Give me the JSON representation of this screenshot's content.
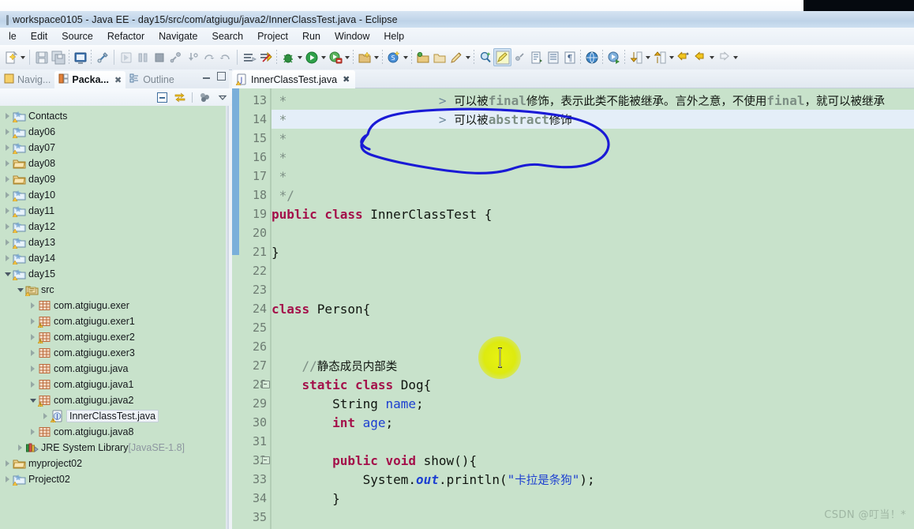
{
  "window": {
    "title": "workspace0105 - Java EE - day15/src/com/atgiugu/java2/InnerClassTest.java - Eclipse"
  },
  "menubar": {
    "items": [
      "le",
      "Edit",
      "Source",
      "Refactor",
      "Navigate",
      "Search",
      "Project",
      "Run",
      "Window",
      "Help"
    ]
  },
  "toolbar": {
    "icons": [
      "new-wizard-icon",
      "new-wizard-dropdown",
      "save-icon",
      "save-all-icon",
      "console-icon",
      "link-icon",
      "resume-icon",
      "suspend-icon",
      "terminate-icon",
      "disconnect-icon",
      "step-into-icon",
      "step-over-icon",
      "step-return-icon",
      "build-all-icon",
      "skip-breakpoints-icon",
      "debug-icon",
      "debug-dropdown",
      "run-icon",
      "run-dropdown",
      "run-last-tool-icon",
      "run-last-tool-dropdown",
      "new-java-project-icon",
      "new-java-project-dropdown",
      "new-class-icon",
      "new-class-dropdown",
      "open-type-icon",
      "open-task-icon",
      "pencil-icon",
      "pencil-dropdown",
      "search-icon",
      "yellow-highlight-icon",
      "toggle-mark-icon",
      "next-annotation-icon",
      "previous-annotation-icon",
      "last-edit-icon",
      "open-browser-icon",
      "external-tools-icon",
      "down-arrow-icon",
      "down-arrow-dropdown",
      "up-arrow-icon",
      "up-arrow-dropdown",
      "back-star-icon",
      "back-arrow-icon",
      "back-dropdown",
      "forward-arrow-icon",
      "forward-dropdown"
    ]
  },
  "left_panel": {
    "tabs": [
      {
        "label": "Navig...",
        "icon": "navigator-icon",
        "active": false,
        "closeable": false
      },
      {
        "label": "Packa...",
        "icon": "package-explorer-icon",
        "active": true,
        "closeable": true
      },
      {
        "label": "Outline",
        "icon": "outline-icon",
        "active": false,
        "closeable": false
      }
    ],
    "window_controls": [
      "minimize-icon",
      "maximize-icon"
    ],
    "view_toolbar": [
      "collapse-all-icon",
      "link-with-editor-icon",
      "view-menu-icon",
      "view-chevron-icon"
    ],
    "tree": [
      {
        "label": "Contacts",
        "indent": 0,
        "twisty": "closed",
        "icon": "java-project-icon"
      },
      {
        "label": "day06",
        "indent": 0,
        "twisty": "closed",
        "icon": "java-project-icon"
      },
      {
        "label": "day07",
        "indent": 0,
        "twisty": "closed",
        "icon": "java-project-icon"
      },
      {
        "label": "day08",
        "indent": 0,
        "twisty": "closed",
        "icon": "folder-icon"
      },
      {
        "label": "day09",
        "indent": 0,
        "twisty": "closed",
        "icon": "folder-icon"
      },
      {
        "label": "day10",
        "indent": 0,
        "twisty": "closed",
        "icon": "java-project-icon"
      },
      {
        "label": "day11",
        "indent": 0,
        "twisty": "closed",
        "icon": "java-project-icon"
      },
      {
        "label": "day12",
        "indent": 0,
        "twisty": "closed",
        "icon": "java-project-icon"
      },
      {
        "label": "day13",
        "indent": 0,
        "twisty": "closed",
        "icon": "java-project-icon"
      },
      {
        "label": "day14",
        "indent": 0,
        "twisty": "closed",
        "icon": "java-project-icon"
      },
      {
        "label": "day15",
        "indent": 0,
        "twisty": "open",
        "icon": "java-project-icon"
      },
      {
        "label": "src",
        "indent": 1,
        "twisty": "open",
        "icon": "source-folder-icon"
      },
      {
        "label": "com.atgiugu.exer",
        "indent": 2,
        "twisty": "closed",
        "icon": "package-icon"
      },
      {
        "label": "com.atgiugu.exer1",
        "indent": 2,
        "twisty": "closed",
        "icon": "package-warn-icon"
      },
      {
        "label": "com.atgiugu.exer2",
        "indent": 2,
        "twisty": "closed",
        "icon": "package-warn-icon"
      },
      {
        "label": "com.atgiugu.exer3",
        "indent": 2,
        "twisty": "closed",
        "icon": "package-icon"
      },
      {
        "label": "com.atgiugu.java",
        "indent": 2,
        "twisty": "closed",
        "icon": "package-icon"
      },
      {
        "label": "com.atgiugu.java1",
        "indent": 2,
        "twisty": "closed",
        "icon": "package-icon"
      },
      {
        "label": "com.atgiugu.java2",
        "indent": 2,
        "twisty": "open",
        "icon": "package-warn-icon"
      },
      {
        "label": "InnerClassTest.java",
        "indent": 3,
        "twisty": "closed",
        "icon": "java-file-warn-icon",
        "selected": true
      },
      {
        "label": "com.atgiugu.java8",
        "indent": 2,
        "twisty": "closed",
        "icon": "package-icon"
      },
      {
        "label": "JRE System Library",
        "indent": 1,
        "twisty": "closed",
        "icon": "library-icon",
        "suffix": " [JavaSE-1.8]"
      },
      {
        "label": "myproject02",
        "indent": 0,
        "twisty": "closed",
        "icon": "folder-icon"
      },
      {
        "label": "Project02",
        "indent": 0,
        "twisty": "closed",
        "icon": "java-project-icon"
      }
    ]
  },
  "editor": {
    "tab": {
      "label": "InnerClassTest.java",
      "icon": "java-file-warn-icon",
      "close": "✖"
    },
    "first_line": 13,
    "current_line": 14,
    "lines": [
      {
        "n": 13,
        "fold": false,
        "segments": [
          {
            "t": " *",
            "c": "cmt"
          },
          {
            "t": "                    ",
            "c": "cmt"
          },
          {
            "t": "> ",
            "c": "doc-gt"
          },
          {
            "t": "可以被",
            "c": "cmt-cjk"
          },
          {
            "t": "final",
            "c": "cmt mono-b"
          },
          {
            "t": "修饰，表示此类不能被继承。言外之意，不使用",
            "c": "cmt-cjk"
          },
          {
            "t": "final",
            "c": "cmt mono-b"
          },
          {
            "t": "，就可以被继承",
            "c": "cmt-cjk"
          }
        ]
      },
      {
        "n": 14,
        "fold": false,
        "segments": [
          {
            "t": " *",
            "c": "cmt"
          },
          {
            "t": "                    ",
            "c": "cmt"
          },
          {
            "t": "> ",
            "c": "doc-gt"
          },
          {
            "t": "可以被",
            "c": "cmt-cjk"
          },
          {
            "t": "abstract",
            "c": "cmt mono-b"
          },
          {
            "t": "修饰",
            "c": "cmt-cjk"
          }
        ]
      },
      {
        "n": 15,
        "fold": false,
        "segments": [
          {
            "t": " *",
            "c": "cmt"
          }
        ]
      },
      {
        "n": 16,
        "fold": false,
        "segments": [
          {
            "t": " *",
            "c": "cmt"
          }
        ]
      },
      {
        "n": 17,
        "fold": false,
        "segments": [
          {
            "t": " *",
            "c": "cmt"
          }
        ]
      },
      {
        "n": 18,
        "fold": false,
        "segments": [
          {
            "t": " */",
            "c": "cmt"
          }
        ]
      },
      {
        "n": 19,
        "fold": false,
        "segments": [
          {
            "t": "public class ",
            "c": "kw"
          },
          {
            "t": "InnerClassTest {",
            "c": ""
          }
        ]
      },
      {
        "n": 20,
        "fold": false,
        "segments": []
      },
      {
        "n": 21,
        "fold": false,
        "segments": [
          {
            "t": "}",
            "c": ""
          }
        ]
      },
      {
        "n": 22,
        "fold": false,
        "segments": []
      },
      {
        "n": 23,
        "fold": false,
        "segments": []
      },
      {
        "n": 24,
        "fold": false,
        "segments": [
          {
            "t": "class ",
            "c": "kw"
          },
          {
            "t": "Person{",
            "c": ""
          }
        ]
      },
      {
        "n": 25,
        "fold": false,
        "segments": []
      },
      {
        "n": 26,
        "fold": false,
        "segments": []
      },
      {
        "n": 27,
        "fold": false,
        "segments": [
          {
            "t": "    //",
            "c": "cmt"
          },
          {
            "t": "静态成员内部类",
            "c": "cmt-cjk"
          }
        ]
      },
      {
        "n": 28,
        "fold": true,
        "segments": [
          {
            "t": "    ",
            "c": ""
          },
          {
            "t": "static class ",
            "c": "kw"
          },
          {
            "t": "Dog{",
            "c": ""
          }
        ]
      },
      {
        "n": 29,
        "fold": false,
        "segments": [
          {
            "t": "        String ",
            "c": ""
          },
          {
            "t": "name",
            "c": "fld"
          },
          {
            "t": ";",
            "c": ""
          }
        ]
      },
      {
        "n": 30,
        "fold": false,
        "segments": [
          {
            "t": "        ",
            "c": ""
          },
          {
            "t": "int ",
            "c": "kw"
          },
          {
            "t": "age",
            "c": "fld"
          },
          {
            "t": ";",
            "c": ""
          }
        ]
      },
      {
        "n": 31,
        "fold": false,
        "segments": []
      },
      {
        "n": 32,
        "fold": true,
        "segments": [
          {
            "t": "        ",
            "c": ""
          },
          {
            "t": "public void ",
            "c": "kw"
          },
          {
            "t": "show(){",
            "c": ""
          }
        ]
      },
      {
        "n": 33,
        "fold": false,
        "segments": [
          {
            "t": "            System.",
            "c": ""
          },
          {
            "t": "out",
            "c": "fld-it"
          },
          {
            "t": ".println(",
            "c": ""
          },
          {
            "t": "\"",
            "c": "str"
          },
          {
            "t": "卡拉是条狗",
            "c": "str-cjk"
          },
          {
            "t": "\"",
            "c": "str"
          },
          {
            "t": ");",
            "c": ""
          }
        ]
      },
      {
        "n": 34,
        "fold": false,
        "segments": [
          {
            "t": "        }",
            "c": ""
          }
        ]
      },
      {
        "n": 35,
        "fold": false,
        "segments": []
      }
    ]
  },
  "annotations": {
    "ink_color": "#1a1ad6",
    "cursor_highlight_color": "#dded10",
    "watermark": "CSDN @叮当！*"
  },
  "colors": {
    "editor_background": "#c8e2cb",
    "tree_background": "#c8e2cb",
    "current_line": "#e4eef8",
    "keyword": "#a4104a",
    "comment": "#7d8f85",
    "field": "#1c3fd1",
    "change_bar": "#6ca6dd"
  }
}
